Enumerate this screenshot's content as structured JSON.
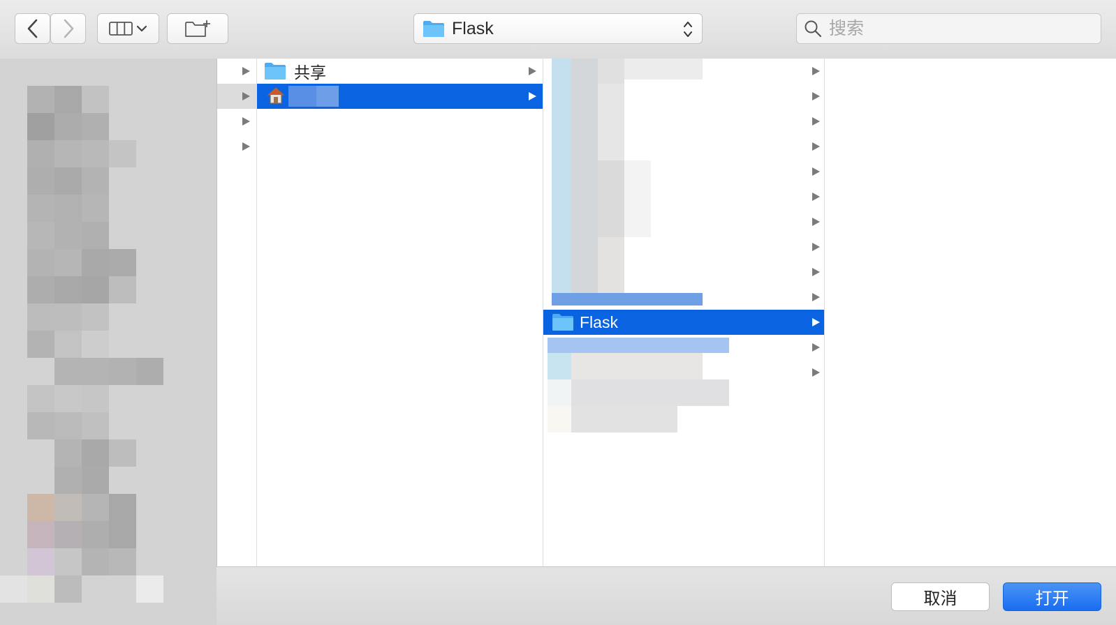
{
  "toolbar": {
    "back_icon": "chevron-left-icon",
    "forward_icon": "chevron-right-icon",
    "view_icon": "column-view-icon",
    "new_folder_icon": "new-folder-icon",
    "path_popup_label": "Flask",
    "search_placeholder": "搜索"
  },
  "columns": [
    {
      "items": [
        {
          "name": "共享",
          "icon": "folder-icon",
          "selected": false
        },
        {
          "name": "",
          "icon": "home-icon",
          "selected": true
        }
      ]
    },
    {
      "items": [
        {
          "name": "Flask",
          "icon": "folder-icon",
          "selected": true
        }
      ]
    }
  ],
  "footer": {
    "cancel_label": "取消",
    "open_label": "打开"
  },
  "colors": {
    "selection": "#0a63e0",
    "accent_button": "#1a6df0",
    "folder": "#5cb8f5"
  }
}
